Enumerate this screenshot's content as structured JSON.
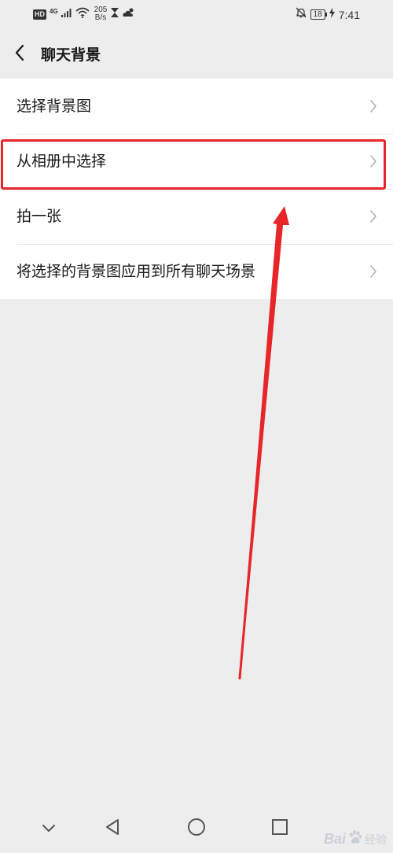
{
  "status_bar": {
    "hd_badge": "HD",
    "network_gen": "4G",
    "net_speed_value": "205",
    "net_speed_unit": "B/s",
    "battery_level": "18",
    "time": "7:41",
    "icons": [
      "signal-icon",
      "wifi-icon",
      "hourglass-icon",
      "weather-icon",
      "mute-bell-icon",
      "battery-icon",
      "charging-icon"
    ]
  },
  "header": {
    "title": "聊天背景",
    "back_icon": "chevron-left-icon"
  },
  "menu": {
    "items": [
      {
        "label": "选择背景图"
      },
      {
        "label": "从相册中选择"
      },
      {
        "label": "拍一张"
      },
      {
        "label": "将选择的背景图应用到所有聊天场景"
      }
    ]
  },
  "annotation": {
    "highlight_color": "#e8262a",
    "highlighted_item": "从相册中选择"
  },
  "system_nav": {
    "buttons": [
      "collapse-icon",
      "back-triangle-icon",
      "home-circle-icon",
      "recents-square-icon"
    ]
  },
  "watermark": {
    "brand": "Bai",
    "sub": "经验"
  },
  "colors": {
    "background": "#ededed",
    "list_background": "#ffffff",
    "text": "#191919",
    "accent_red": "#e8262a"
  }
}
